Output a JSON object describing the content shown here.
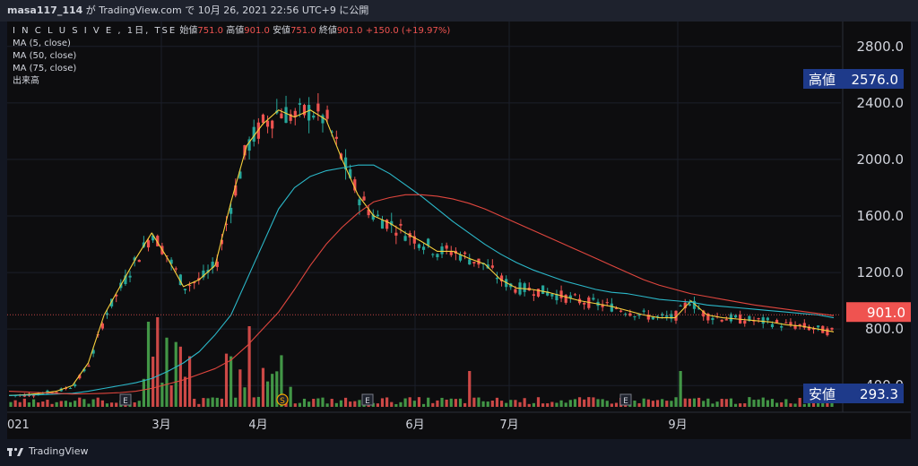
{
  "topbar": {
    "author": "masa117_114",
    "text": " が TradingView.com で 10月 26, 2021 22:56 UTC+9 に公開"
  },
  "legend": {
    "symbol": "I N C L U S I V E , 1日, TSE",
    "open_label": "始値",
    "open": "751.0",
    "high_label": "高値",
    "high": "901.0",
    "low_label": "安値",
    "low": "751.0",
    "close_label": "終値",
    "close": "901.0",
    "change": "+150.0 (+19.97%)",
    "ma5": "MA (5, close)",
    "ma50": "MA (50, close)",
    "ma75": "MA (75, close)",
    "volume": "出来高"
  },
  "price_axis": {
    "ticks": [
      "2800.0",
      "2400.0",
      "2000.0",
      "1600.0",
      "1200.0",
      "800.0",
      "400.0"
    ]
  },
  "markers": {
    "high_label": "高値",
    "high_value": "2576.0",
    "current_value": "901.0",
    "low_label": "安値",
    "low_value": "293.3"
  },
  "time_axis": {
    "labels": [
      "021",
      "3月",
      "4月",
      "6月",
      "7月",
      "9月"
    ]
  },
  "events": {
    "earnings": "E",
    "split": "S"
  },
  "brand": "TradingView",
  "colors": {
    "up": "#26a69a",
    "down": "#ef5350",
    "vol_up": "#4caf50",
    "vol_down": "#ef5350",
    "ma5": "#f7d03c",
    "ma50": "#2bb8c9",
    "ma75": "#e0463e",
    "marker_bg": "#1e3a8a"
  },
  "chart_data": {
    "type": "candlestick",
    "ylim": [
      300,
      2900
    ],
    "series": [
      {
        "name": "MA (5, close)",
        "values": [
          330,
          335,
          345,
          360,
          400,
          560,
          900,
          1100,
          1300,
          1480,
          1300,
          1100,
          1150,
          1250,
          1700,
          2100,
          2250,
          2350,
          2300,
          2350,
          2280,
          2000,
          1750,
          1600,
          1550,
          1480,
          1420,
          1350,
          1350,
          1300,
          1260,
          1150,
          1090,
          1080,
          1060,
          1030,
          1000,
          980,
          960,
          930,
          900,
          880,
          880,
          1000,
          900,
          880,
          870,
          860,
          850,
          830,
          820,
          800,
          780
        ]
      },
      {
        "name": "MA (50, close)",
        "values": [
          330,
          332,
          335,
          340,
          345,
          360,
          380,
          400,
          420,
          450,
          500,
          560,
          640,
          760,
          900,
          1150,
          1400,
          1650,
          1800,
          1880,
          1920,
          1940,
          1960,
          1960,
          1900,
          1820,
          1740,
          1650,
          1560,
          1480,
          1400,
          1330,
          1270,
          1220,
          1180,
          1140,
          1110,
          1080,
          1060,
          1050,
          1030,
          1010,
          1000,
          990,
          970,
          960,
          950,
          940,
          930,
          920,
          910,
          900,
          880
        ]
      },
      {
        "name": "MA (75, close)",
        "values": [
          360,
          355,
          350,
          345,
          340,
          342,
          345,
          350,
          360,
          380,
          410,
          440,
          480,
          520,
          580,
          680,
          800,
          920,
          1080,
          1250,
          1400,
          1520,
          1620,
          1700,
          1730,
          1750,
          1750,
          1740,
          1720,
          1690,
          1650,
          1600,
          1550,
          1500,
          1450,
          1400,
          1350,
          1300,
          1250,
          1200,
          1150,
          1110,
          1080,
          1050,
          1030,
          1010,
          990,
          970,
          955,
          940,
          925,
          910,
          895
        ]
      }
    ],
    "volume_note": "volume bars shown at bottom"
  }
}
